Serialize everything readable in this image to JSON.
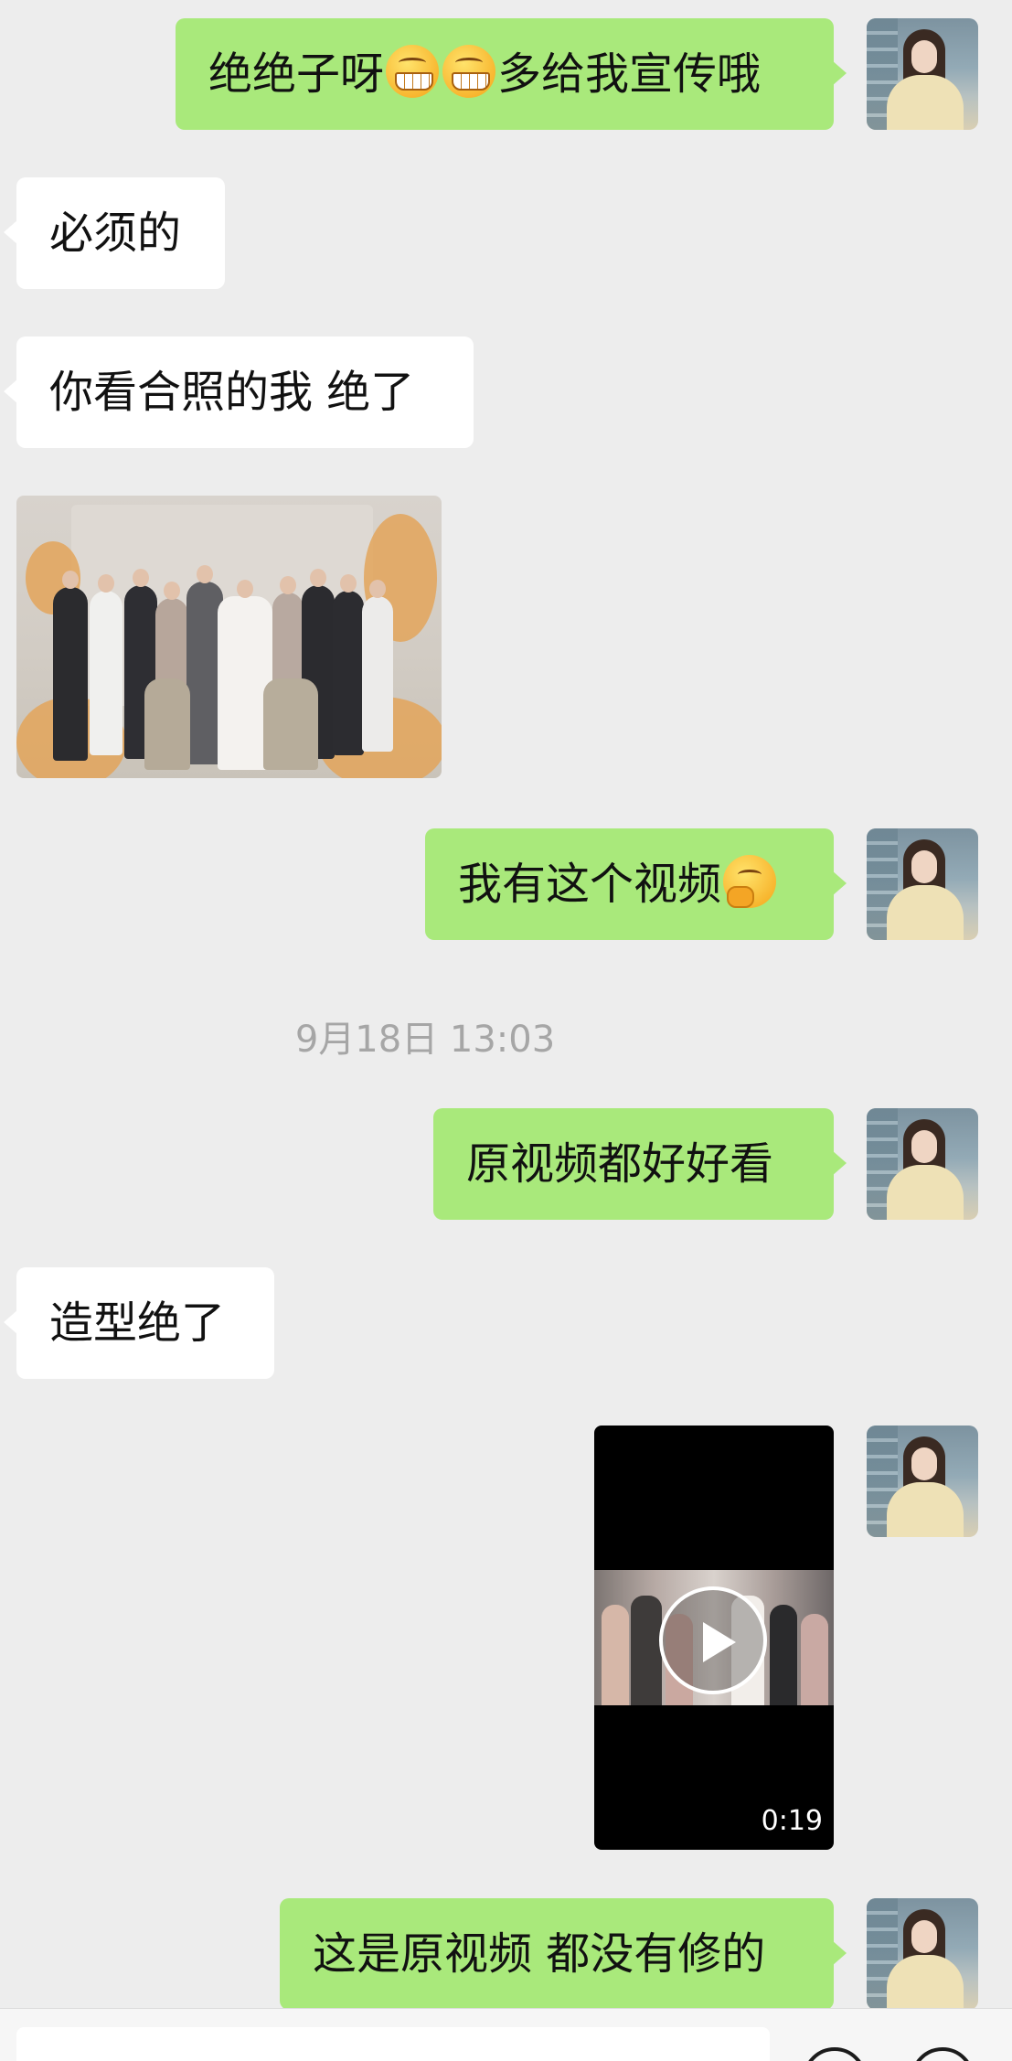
{
  "messages": [
    {
      "side": "right",
      "text_a": "绝绝子呀",
      "text_b": "多给我宣传哦",
      "emoji": [
        "grinning-face-emoji",
        "grinning-face-emoji"
      ]
    },
    {
      "side": "left",
      "text": "必须的"
    },
    {
      "side": "left",
      "text": "你看合照的我 绝了"
    },
    {
      "side": "left",
      "type": "image",
      "image": "group-wedding-photo"
    },
    {
      "side": "right",
      "text": "我有这个视频",
      "emoji": [
        "thinking-face-emoji"
      ]
    },
    {
      "side": "right",
      "text": "原视频都好好看"
    },
    {
      "side": "left",
      "text": "造型绝了"
    },
    {
      "side": "right",
      "type": "video",
      "duration": "0:19"
    },
    {
      "side": "right",
      "text": "这是原视频 都没有修的"
    }
  ],
  "timestamp": "9月18日 13:03",
  "colors": {
    "background": "#ededed",
    "sent_bubble": "#a9e97b",
    "received_bubble": "#ffffff",
    "timestamp": "#a6a6a6"
  }
}
